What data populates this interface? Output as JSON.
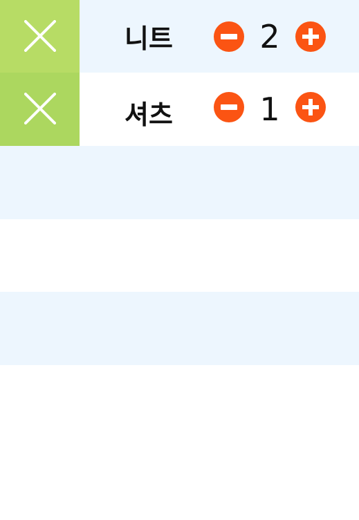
{
  "cart": {
    "items": [
      {
        "name": "니트",
        "quantity": "2"
      },
      {
        "name": "셔츠",
        "quantity": "1"
      }
    ]
  },
  "icons": {
    "delete": "close-icon",
    "decrease": "minus-circle-icon",
    "increase": "plus-circle-icon"
  },
  "colors": {
    "delete_bg_1": "#b7dc65",
    "delete_bg_2": "#acd75f",
    "stepper": "#fb5413",
    "row_alt": "#edf6fe"
  }
}
